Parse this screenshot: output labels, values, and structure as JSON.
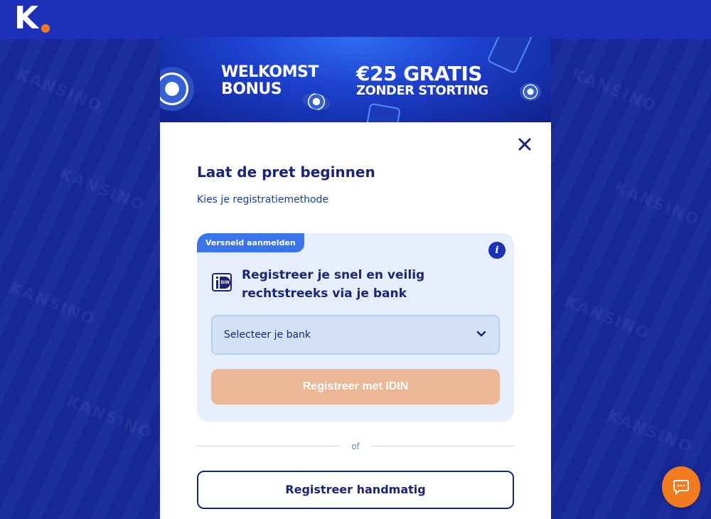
{
  "brand": {
    "logo_letter": "K",
    "accent_color": "#f47a1f",
    "primary_color": "#1c31b8"
  },
  "banner": {
    "left_line1": "WELKOMST",
    "left_line2": "BONUS",
    "right_line1": "€25 GRATIS",
    "right_line2": "ZONDER STORTING"
  },
  "modal": {
    "close_icon": "close-icon",
    "title": "Laat de pret beginnen",
    "subtitle": "Kies je registratiemethode"
  },
  "idin": {
    "tag": "Versneld aanmelden",
    "info_icon": "info-icon",
    "heading": "Registreer je snel en veilig rechtstreeks via je bank",
    "bank_select_value": "Selecteer je bank",
    "submit_label": "Registreer met IDIN"
  },
  "divider": {
    "label": "of"
  },
  "manual": {
    "label": "Registreer handmatig"
  },
  "chat": {
    "icon": "chat-icon"
  }
}
